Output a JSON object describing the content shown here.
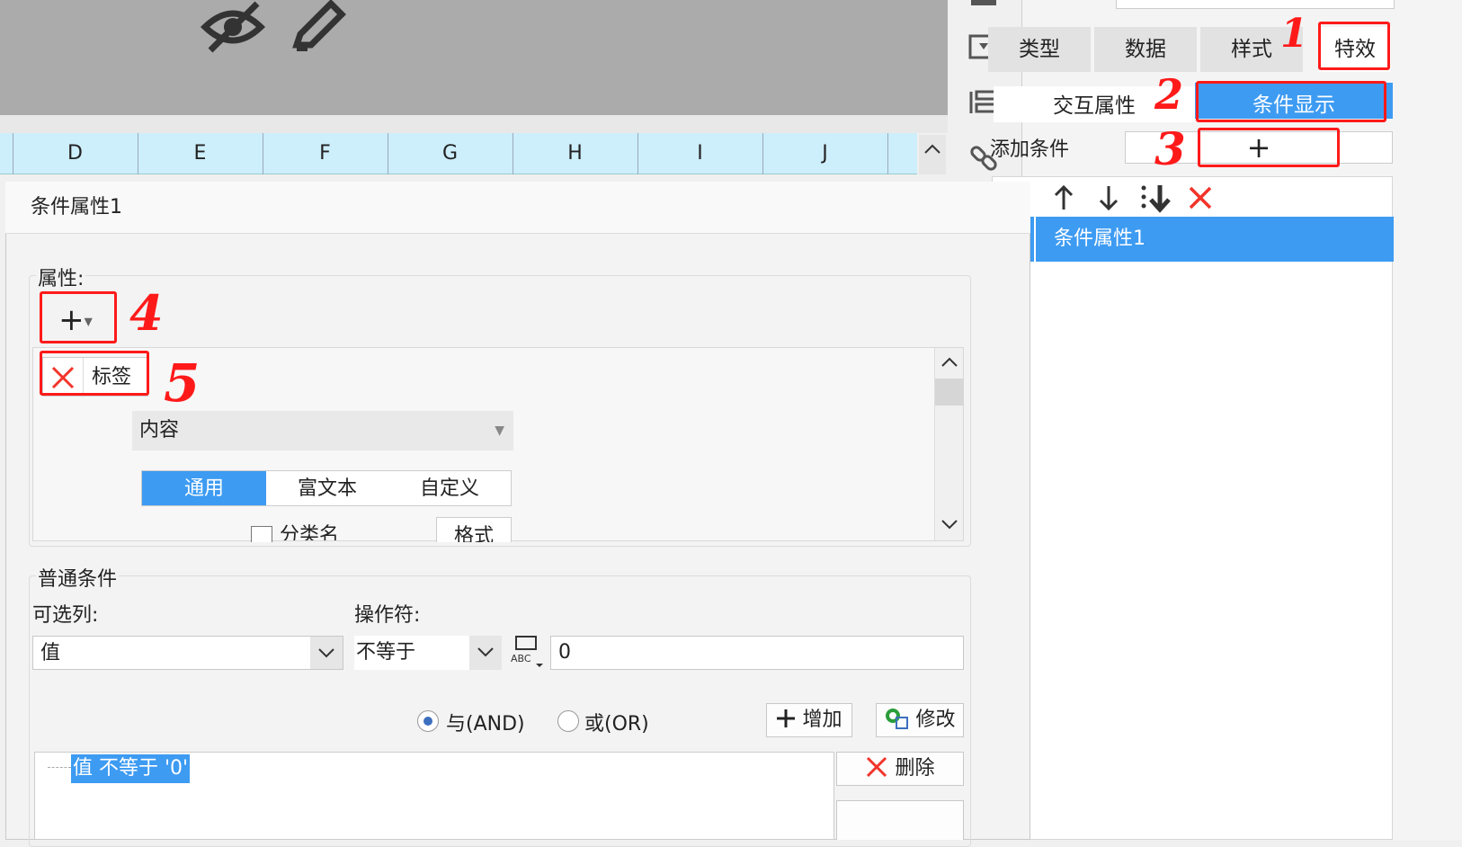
{
  "spreadsheet": {
    "columns": [
      "D",
      "E",
      "F",
      "G",
      "H",
      "I",
      "J"
    ]
  },
  "right_panel": {
    "top_tabs": [
      "类型",
      "数据",
      "样式",
      "特效"
    ],
    "sub_tabs": [
      "交互属性",
      "条件显示"
    ],
    "add_condition_label": "添加条件",
    "add_button": "+",
    "list_items": [
      "条件属性1"
    ]
  },
  "dialog": {
    "title": "条件属性1",
    "property_label": "属性:",
    "add_prop_button": "+",
    "prop_item_label": "标签",
    "content_select": "内容",
    "format_tabs": [
      "通用",
      "富文本",
      "自定义"
    ],
    "checkbox_label": "分类名",
    "format_button": "格式",
    "normal_condition_label": "普通条件",
    "column_label": "可选列:",
    "column_value": "值",
    "operator_label": "操作符:",
    "operator_value": "不等于",
    "value_input": "0",
    "radio_and": "与(AND)",
    "radio_or": "或(OR)",
    "add_btn": "增加",
    "modify_btn": "修改",
    "delete_btn": "删除",
    "condition_expr": "值 不等于 '0'"
  },
  "annotations": [
    "1",
    "2",
    "3",
    "4",
    "5"
  ],
  "colors": {
    "accent_blue": "#3d9bf2",
    "annotation_red": "#ff1a1a",
    "column_header_bg": "#cdeefb"
  }
}
